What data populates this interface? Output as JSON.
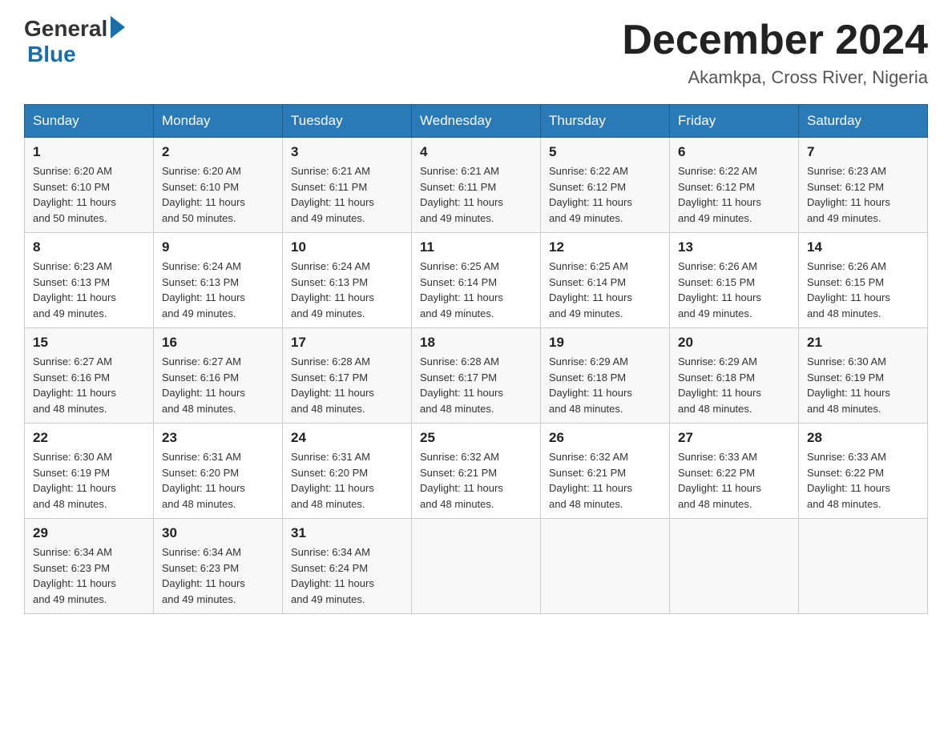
{
  "header": {
    "logo_general": "General",
    "logo_blue": "Blue",
    "month_title": "December 2024",
    "location": "Akamkpa, Cross River, Nigeria"
  },
  "days_of_week": [
    "Sunday",
    "Monday",
    "Tuesday",
    "Wednesday",
    "Thursday",
    "Friday",
    "Saturday"
  ],
  "weeks": [
    [
      {
        "day": "1",
        "sunrise": "6:20 AM",
        "sunset": "6:10 PM",
        "daylight": "11 hours and 50 minutes."
      },
      {
        "day": "2",
        "sunrise": "6:20 AM",
        "sunset": "6:10 PM",
        "daylight": "11 hours and 50 minutes."
      },
      {
        "day": "3",
        "sunrise": "6:21 AM",
        "sunset": "6:11 PM",
        "daylight": "11 hours and 49 minutes."
      },
      {
        "day": "4",
        "sunrise": "6:21 AM",
        "sunset": "6:11 PM",
        "daylight": "11 hours and 49 minutes."
      },
      {
        "day": "5",
        "sunrise": "6:22 AM",
        "sunset": "6:12 PM",
        "daylight": "11 hours and 49 minutes."
      },
      {
        "day": "6",
        "sunrise": "6:22 AM",
        "sunset": "6:12 PM",
        "daylight": "11 hours and 49 minutes."
      },
      {
        "day": "7",
        "sunrise": "6:23 AM",
        "sunset": "6:12 PM",
        "daylight": "11 hours and 49 minutes."
      }
    ],
    [
      {
        "day": "8",
        "sunrise": "6:23 AM",
        "sunset": "6:13 PM",
        "daylight": "11 hours and 49 minutes."
      },
      {
        "day": "9",
        "sunrise": "6:24 AM",
        "sunset": "6:13 PM",
        "daylight": "11 hours and 49 minutes."
      },
      {
        "day": "10",
        "sunrise": "6:24 AM",
        "sunset": "6:13 PM",
        "daylight": "11 hours and 49 minutes."
      },
      {
        "day": "11",
        "sunrise": "6:25 AM",
        "sunset": "6:14 PM",
        "daylight": "11 hours and 49 minutes."
      },
      {
        "day": "12",
        "sunrise": "6:25 AM",
        "sunset": "6:14 PM",
        "daylight": "11 hours and 49 minutes."
      },
      {
        "day": "13",
        "sunrise": "6:26 AM",
        "sunset": "6:15 PM",
        "daylight": "11 hours and 49 minutes."
      },
      {
        "day": "14",
        "sunrise": "6:26 AM",
        "sunset": "6:15 PM",
        "daylight": "11 hours and 48 minutes."
      }
    ],
    [
      {
        "day": "15",
        "sunrise": "6:27 AM",
        "sunset": "6:16 PM",
        "daylight": "11 hours and 48 minutes."
      },
      {
        "day": "16",
        "sunrise": "6:27 AM",
        "sunset": "6:16 PM",
        "daylight": "11 hours and 48 minutes."
      },
      {
        "day": "17",
        "sunrise": "6:28 AM",
        "sunset": "6:17 PM",
        "daylight": "11 hours and 48 minutes."
      },
      {
        "day": "18",
        "sunrise": "6:28 AM",
        "sunset": "6:17 PM",
        "daylight": "11 hours and 48 minutes."
      },
      {
        "day": "19",
        "sunrise": "6:29 AM",
        "sunset": "6:18 PM",
        "daylight": "11 hours and 48 minutes."
      },
      {
        "day": "20",
        "sunrise": "6:29 AM",
        "sunset": "6:18 PM",
        "daylight": "11 hours and 48 minutes."
      },
      {
        "day": "21",
        "sunrise": "6:30 AM",
        "sunset": "6:19 PM",
        "daylight": "11 hours and 48 minutes."
      }
    ],
    [
      {
        "day": "22",
        "sunrise": "6:30 AM",
        "sunset": "6:19 PM",
        "daylight": "11 hours and 48 minutes."
      },
      {
        "day": "23",
        "sunrise": "6:31 AM",
        "sunset": "6:20 PM",
        "daylight": "11 hours and 48 minutes."
      },
      {
        "day": "24",
        "sunrise": "6:31 AM",
        "sunset": "6:20 PM",
        "daylight": "11 hours and 48 minutes."
      },
      {
        "day": "25",
        "sunrise": "6:32 AM",
        "sunset": "6:21 PM",
        "daylight": "11 hours and 48 minutes."
      },
      {
        "day": "26",
        "sunrise": "6:32 AM",
        "sunset": "6:21 PM",
        "daylight": "11 hours and 48 minutes."
      },
      {
        "day": "27",
        "sunrise": "6:33 AM",
        "sunset": "6:22 PM",
        "daylight": "11 hours and 48 minutes."
      },
      {
        "day": "28",
        "sunrise": "6:33 AM",
        "sunset": "6:22 PM",
        "daylight": "11 hours and 48 minutes."
      }
    ],
    [
      {
        "day": "29",
        "sunrise": "6:34 AM",
        "sunset": "6:23 PM",
        "daylight": "11 hours and 49 minutes."
      },
      {
        "day": "30",
        "sunrise": "6:34 AM",
        "sunset": "6:23 PM",
        "daylight": "11 hours and 49 minutes."
      },
      {
        "day": "31",
        "sunrise": "6:34 AM",
        "sunset": "6:24 PM",
        "daylight": "11 hours and 49 minutes."
      },
      null,
      null,
      null,
      null
    ]
  ],
  "labels": {
    "sunrise": "Sunrise:",
    "sunset": "Sunset:",
    "daylight": "Daylight:"
  }
}
